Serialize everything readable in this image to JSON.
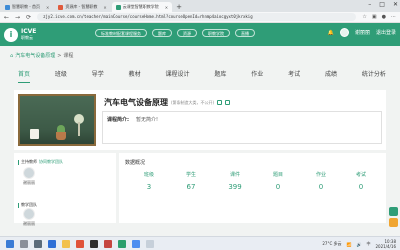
{
  "browser": {
    "tabs": [
      {
        "title": "智慧职教 - 首页",
        "active": false,
        "favicon_color": "#3d8bd6"
      },
      {
        "title": "资源库 - 智慧职教",
        "active": false,
        "favicon_color": "#e05a3c"
      },
      {
        "title": "云课堂智慧职教学院",
        "active": true,
        "favicon_color": "#2f9d77"
      }
    ],
    "new_tab": "+",
    "window_controls": [
      "–",
      "□",
      "✕"
    ],
    "url": "zjy2.icve.com.cn/teacher/mainCourse/courseHome.html?courseOpenId=rhnmp4aiocgyxt0jkrxkig",
    "nav": {
      "back": "←",
      "forward": "→",
      "refresh": "⟳"
    }
  },
  "site": {
    "logo_letter": "i",
    "logo_line1": "ICVE",
    "logo_line2": "职教云",
    "header_buttons": [
      "标准教材配套课程服务",
      "题库",
      "资源",
      "职教学院",
      "直播"
    ],
    "user_name": "谢丽丽",
    "header_right_label": "退出登录",
    "brand_color": "#2f9d77"
  },
  "breadcrumb": {
    "home_icon": "⌂",
    "items": [
      "汽车电气设备原理",
      "课程"
    ],
    "separator": ">"
  },
  "nav_tabs": [
    "首页",
    "班级",
    "导学",
    "教材",
    "课程设计",
    "题库",
    "作业",
    "考试",
    "成绩",
    "统计分析"
  ],
  "active_tab": "首页",
  "course": {
    "title": "汽车电气设备原理",
    "meta": "(第条制造大类，不公开)",
    "intro_label": "课程简介:",
    "intro_value": "暂无简介!"
  },
  "teachers": {
    "main_label": "主持教师",
    "main_sub": "协同教学团队",
    "main_name": "谢丽丽",
    "team_label": "教学团队",
    "team_sub": "",
    "team_name": "谢丽丽"
  },
  "stats": {
    "title": "数据概况",
    "items": [
      {
        "label": "班级",
        "value": "3"
      },
      {
        "label": "学生",
        "value": "67"
      },
      {
        "label": "课件",
        "value": "399"
      },
      {
        "label": "题目",
        "value": "0"
      },
      {
        "label": "作业",
        "value": "0"
      },
      {
        "label": "考试",
        "value": "0"
      }
    ]
  },
  "taskbar": {
    "weather": "27°C 多云",
    "time": "10:38",
    "date": "2021/4/16",
    "lang": "中"
  }
}
